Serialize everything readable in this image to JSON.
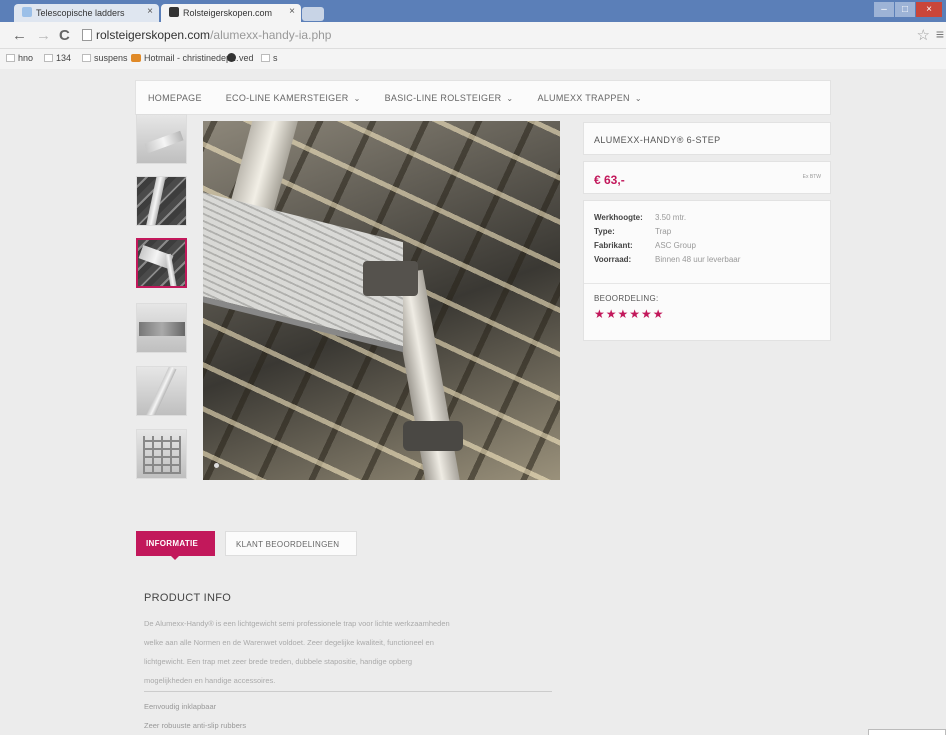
{
  "browser": {
    "tabs": [
      {
        "label": "Telescopische ladders",
        "active": false
      },
      {
        "label": "Rolsteigerskopen.com",
        "active": true
      }
    ],
    "tab_close": "×",
    "url": {
      "host": "rolsteigerskopen.com",
      "path": "/alumexx-handy-ia.php"
    },
    "bookmarks": [
      "hno",
      "134",
      "suspens",
      "Hotmail - christinedep...",
      "ved",
      "s"
    ],
    "window_buttons": [
      "–",
      "□",
      "×"
    ]
  },
  "nav": {
    "items": [
      {
        "label": "HOMEPAGE",
        "has_caret": false
      },
      {
        "label": "ECO-LINE KAMERSTEIGER",
        "has_caret": true
      },
      {
        "label": "BASIC-LINE ROLSTEIGER",
        "has_caret": true
      },
      {
        "label": "ALUMEXX TRAPPEN",
        "has_caret": true
      }
    ]
  },
  "product": {
    "title": "ALUMEXX-HANDY® 6-STEP",
    "price": "€ 63,-",
    "price_note": "Ex BTW",
    "specs": [
      {
        "label": "Werkhoogte:",
        "value": "3.50 mtr."
      },
      {
        "label": "Type:",
        "value": "Trap"
      },
      {
        "label": "Fabrikant:",
        "value": "ASC Group"
      },
      {
        "label": "Voorraad:",
        "value": "Binnen 48 uur leverbaar"
      }
    ],
    "rating_label": "BEOORDELING:",
    "rating": 6,
    "rating_max": 6,
    "stars": "★★★★★★",
    "thumbnail_count": 6,
    "active_thumbnail": 3
  },
  "tabs": {
    "info": "INFORMATIE",
    "reviews": "KLANT BEOORDELINGEN"
  },
  "info": {
    "title": "PRODUCT INFO",
    "paragraph_lines": [
      "De Alumexx-Handy® is een lichtgewicht semi professionele trap voor lichte werkzaamheden",
      "welke aan alle Normen en de Warenwet voldoet. Zeer degelijke kwaliteit, functioneel en",
      "lichtgewicht. Een trap met zeer brede treden, dubbele stapositie, handige opberg",
      "mogelijkheden en handige accessoires."
    ],
    "bullets": [
      "Eenvoudig inklapbaar",
      "Zeer robuuste anti-slip rubbers"
    ]
  },
  "colors": {
    "accent": "#c2185b",
    "chrome": "#5b7fb8"
  },
  "icons": [
    "back-arrow-icon",
    "forward-arrow-icon",
    "reload-icon",
    "bookmark-star-icon",
    "menu-icon",
    "chevron-down-icon",
    "star-icon"
  ]
}
